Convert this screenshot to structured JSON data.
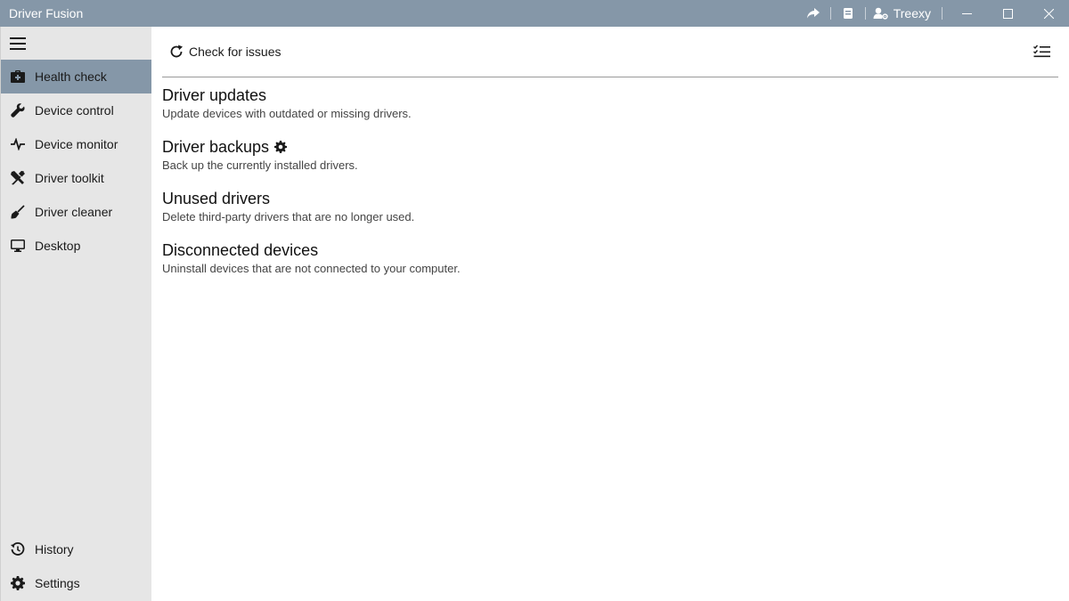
{
  "window": {
    "title": "Driver Fusion",
    "user_name": "Treexy",
    "icons": [
      "share-icon",
      "book-icon",
      "user-settings-icon",
      "minimize-icon",
      "maximize-icon",
      "close-icon"
    ]
  },
  "sidebar": {
    "menu_icon": "hamburger-icon",
    "items": [
      {
        "label": "Health check",
        "icon": "medkit-icon",
        "active": true
      },
      {
        "label": "Device control",
        "icon": "wrench-icon"
      },
      {
        "label": "Device monitor",
        "icon": "pulse-icon"
      },
      {
        "label": "Driver toolkit",
        "icon": "tools-icon"
      },
      {
        "label": "Driver cleaner",
        "icon": "broom-icon"
      },
      {
        "label": "Desktop",
        "icon": "monitor-icon"
      }
    ],
    "bottom_items": [
      {
        "label": "History",
        "icon": "history-icon"
      },
      {
        "label": "Settings",
        "icon": "gear-icon"
      }
    ]
  },
  "toolbar": {
    "check_label": "Check for issues",
    "check_icon": "refresh-icon",
    "list_icon": "checklist-icon"
  },
  "sections": [
    {
      "title": "Driver updates",
      "description": "Update devices with outdated or missing drivers."
    },
    {
      "title": "Driver backups",
      "description": "Back up the currently installed drivers.",
      "icon": "gear-icon"
    },
    {
      "title": "Unused drivers",
      "description": "Delete third-party drivers that are no longer used."
    },
    {
      "title": "Disconnected devices",
      "description": "Uninstall devices that are not connected to your computer."
    }
  ],
  "colors": {
    "titlebar": "#8597a8",
    "active_nav": "#8597a8",
    "sidebar": "#e6e6e6"
  }
}
